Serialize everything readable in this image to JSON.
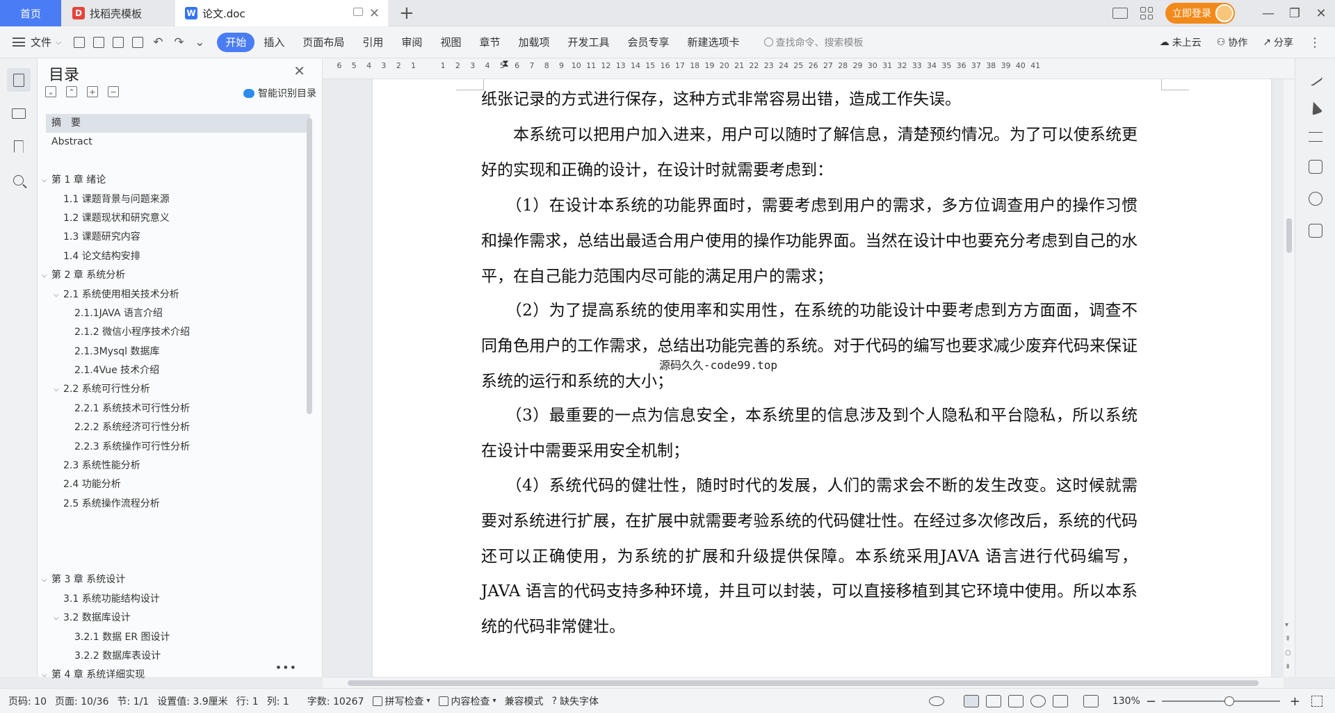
{
  "tabs": {
    "home": "首页",
    "template": "找稻壳模板",
    "document": "论文.doc"
  },
  "titlebar": {
    "login": "立即登录"
  },
  "ribbon": {
    "file": "文件",
    "tabs": [
      "开始",
      "插入",
      "页面布局",
      "引用",
      "审阅",
      "视图",
      "章节",
      "加载项",
      "开发工具",
      "会员专享",
      "新建选项卡"
    ],
    "search_placeholder": "查找命令、搜索模板",
    "cloud": "未上云",
    "collab": "协作",
    "share": "分享"
  },
  "toc": {
    "title": "目录",
    "smart_label": "智能识别目录",
    "items": [
      {
        "label": "摘　要",
        "level": 0,
        "toggle": ""
      },
      {
        "label": "Abstract",
        "level": 0,
        "toggle": ""
      },
      {
        "label": "",
        "level": 0,
        "toggle": ""
      },
      {
        "label": "第 1 章  绪论",
        "level": 0,
        "toggle": "down"
      },
      {
        "label": "1.1 课题背景与问题来源",
        "level": 1,
        "toggle": ""
      },
      {
        "label": "1.2 课题现状和研究意义",
        "level": 1,
        "toggle": ""
      },
      {
        "label": "1.3 课题研究内容",
        "level": 1,
        "toggle": ""
      },
      {
        "label": "1.4 论文结构安排",
        "level": 1,
        "toggle": ""
      },
      {
        "label": "第 2 章  系统分析",
        "level": 0,
        "toggle": "down"
      },
      {
        "label": "2.1 系统使用相关技术分析",
        "level": 1,
        "toggle": "down"
      },
      {
        "label": "2.1.1JAVA 语言介绍",
        "level": 2,
        "toggle": ""
      },
      {
        "label": "2.1.2 微信小程序技术介绍",
        "level": 2,
        "toggle": ""
      },
      {
        "label": "2.1.3Mysql 数据库",
        "level": 2,
        "toggle": ""
      },
      {
        "label": "2.1.4Vue 技术介绍",
        "level": 2,
        "toggle": ""
      },
      {
        "label": "2.2 系统可行性分析",
        "level": 1,
        "toggle": "down"
      },
      {
        "label": "2.2.1 系统技术可行性分析",
        "level": 2,
        "toggle": ""
      },
      {
        "label": "2.2.2 系统经济可行性分析",
        "level": 2,
        "toggle": ""
      },
      {
        "label": "2.2.3 系统操作可行性分析",
        "level": 2,
        "toggle": ""
      },
      {
        "label": "2.3 系统性能分析",
        "level": 1,
        "toggle": ""
      },
      {
        "label": "2.4 功能分析",
        "level": 1,
        "toggle": ""
      },
      {
        "label": "2.5 系统操作流程分析",
        "level": 1,
        "toggle": ""
      },
      {
        "label": "",
        "level": 0,
        "toggle": ""
      },
      {
        "label": "",
        "level": 0,
        "toggle": ""
      },
      {
        "label": "",
        "level": 0,
        "toggle": ""
      },
      {
        "label": "第 3 章  系统设计",
        "level": 0,
        "toggle": "down"
      },
      {
        "label": "3.1 系统功能结构设计",
        "level": 1,
        "toggle": ""
      },
      {
        "label": "3.2 数据库设计",
        "level": 1,
        "toggle": "down"
      },
      {
        "label": "3.2.1 数据 ER 图设计",
        "level": 2,
        "toggle": ""
      },
      {
        "label": "3.2.2 数据库表设计",
        "level": 2,
        "toggle": ""
      },
      {
        "label": "第 4 章  系统详细实现",
        "level": 0,
        "toggle": "down"
      }
    ]
  },
  "ruler": {
    "ticks": [
      "6",
      "5",
      "4",
      "3",
      "2",
      "1",
      "",
      "1",
      "2",
      "3",
      "4",
      "5",
      "6",
      "7",
      "8",
      "9",
      "10",
      "11",
      "12",
      "13",
      "14",
      "15",
      "16",
      "17",
      "18",
      "19",
      "20",
      "21",
      "22",
      "23",
      "24",
      "25",
      "26",
      "27",
      "28",
      "29",
      "30",
      "31",
      "32",
      "33",
      "34",
      "35",
      "36",
      "37",
      "38",
      "39",
      "40",
      "41"
    ]
  },
  "document": {
    "paragraphs": [
      "纸张记录的方式进行保存，这种方式非常容易出错，造成工作失误。",
      "　　本系统可以把用户加入进来，用户可以随时了解信息，清楚预约情况。为了可以使系统更好的实现和正确的设计，在设计时就需要考虑到：",
      "　　（1）在设计本系统的功能界面时，需要考虑到用户的需求，多方位调查用户的操作习惯和操作需求，总结出最适合用户使用的操作功能界面。当然在设计中也要充分考虑到自己的水平，在自己能力范围内尽可能的满足用户的需求；",
      "　　（2）为了提高系统的使用率和实用性，在系统的功能设计中要考虑到方方面面，调查不同角色用户的工作需求，总结出功能完善的系统。对于代码的编写也要求减少废弃代码来保证系统的运行和系统的大小；",
      "　　（3）最重要的一点为信息安全，本系统里的信息涉及到个人隐私和平台隐私，所以系统在设计中需要采用安全机制；",
      "　　（4）系统代码的健壮性，随时时代的发展，人们的需求会不断的发生改变。这时候就需要对系统进行扩展，在扩展中就需要考验系统的代码健壮性。在经过多次修改后，系统的代码还可以正确使用，为系统的扩展和升级提供保障。本系统采用JAVA 语言进行代码编写，JAVA 语言的代码支持多种环境，并且可以封装，可以直接移植到其它环境中使用。所以本系统的代码非常健壮。"
    ],
    "watermark": "源码久久-code99.top",
    "heading_peek": "2.4 功能分析"
  },
  "status": {
    "page_num": "页码: 10",
    "pages": "页面: 10/36",
    "section": "节: 1/1",
    "setting": "设置值: 3.9厘米",
    "row": "行: 1",
    "col": "列: 1",
    "words": "字数: 10267",
    "spell": "拼写检查",
    "content_check": "内容检查",
    "compat": "兼容模式",
    "missing_font": "缺失字体",
    "zoom": "130%"
  }
}
